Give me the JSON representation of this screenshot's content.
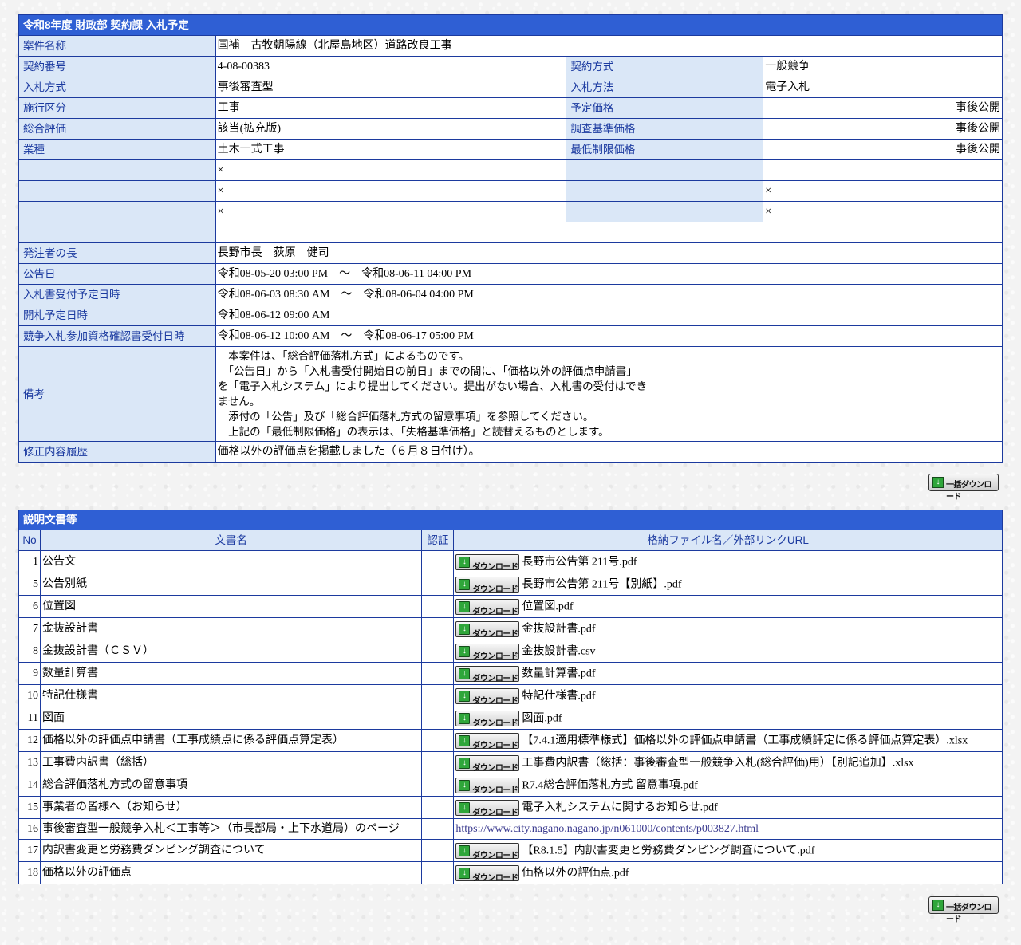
{
  "info": {
    "title": "令和8年度 財政部 契約課 入札予定",
    "case_name_label": "案件名称",
    "case_name": "国補　古牧朝陽線（北屋島地区）道路改良工事",
    "contract_no_label": "契約番号",
    "contract_no": "4-08-00383",
    "contract_method_label": "契約方式",
    "contract_method": "一般競争",
    "bid_type_label": "入札方式",
    "bid_type": "事後審査型",
    "bid_method_label": "入札方法",
    "bid_method": "電子入札",
    "category_label": "施行区分",
    "category": "工事",
    "planned_price_label": "予定価格",
    "planned_price": "事後公開",
    "overall_eval_label": "総合評価",
    "overall_eval": "該当(拡充版)",
    "survey_price_label": "調査基準価格",
    "survey_price": "事後公開",
    "industry_label": "業種",
    "industry": "土木一式工事",
    "min_price_label": "最低制限価格",
    "min_price": "事後公開",
    "mark_x": "×",
    "orderer_label": "発注者の長",
    "orderer": "長野市長　荻原　健司",
    "announce_label": "公告日",
    "announce": "令和08-05-20 03:00 PM　～　令和08-06-11 04:00 PM",
    "receipt_label": "入札書受付予定日時",
    "receipt": "令和08-06-03 08:30 AM　～　令和08-06-04 04:00 PM",
    "opening_label": "開札予定日時",
    "opening": "令和08-06-12 09:00 AM",
    "qualify_label": "競争入札参加資格確認書受付日時",
    "qualify": "令和08-06-12 10:00 AM　～　令和08-06-17 05:00 PM",
    "remarks_label": "備考",
    "remarks": "　本案件は、「総合評価落札方式」によるものです。\n　「公告日」から「入札書受付開始日の前日」までの間に、「価格以外の評価点申請書」\nを「電子入札システム」により提出してください。提出がない場合、入札書の受付はでき\nません。\n　添付の「公告」及び「総合評価落札方式の留意事項」を参照してください。\n　上記の「最低制限価格」の表示は、「失格基準価格」と読替えるものとします。",
    "revision_label": "修正内容履歴",
    "revision": "価格以外の評価点を掲載しました（６月８日付け）。"
  },
  "bulk_download_label": "一括ダウンロード",
  "download_label": "ダウンロード",
  "docs": {
    "title": "説明文書等",
    "col_no": "No",
    "col_name": "文書名",
    "col_auth": "認証",
    "col_file": "格納ファイル名／外部リンクURL",
    "rows": [
      {
        "no": "1",
        "name": "公告文",
        "file": "長野市公告第 211号.pdf"
      },
      {
        "no": "5",
        "name": "公告別紙",
        "file": "長野市公告第 211号【別紙】.pdf"
      },
      {
        "no": "6",
        "name": "位置図",
        "file": "位置図.pdf"
      },
      {
        "no": "7",
        "name": "金抜設計書",
        "file": "金抜設計書.pdf"
      },
      {
        "no": "8",
        "name": "金抜設計書（ＣＳＶ）",
        "file": "金抜設計書.csv"
      },
      {
        "no": "9",
        "name": "数量計算書",
        "file": "数量計算書.pdf"
      },
      {
        "no": "10",
        "name": "特記仕様書",
        "file": "特記仕様書.pdf"
      },
      {
        "no": "11",
        "name": "図面",
        "file": "図面.pdf"
      },
      {
        "no": "12",
        "name": "価格以外の評価点申請書（工事成績点に係る評価点算定表）",
        "file": "【7.4.1適用標準様式】価格以外の評価点申請書（工事成績評定に係る評価点算定表）.xlsx"
      },
      {
        "no": "13",
        "name": "工事費内訳書（総括）",
        "file": "工事費内訳書（総括：事後審査型一般競争入札(総合評価)用）【別記追加】.xlsx"
      },
      {
        "no": "14",
        "name": "総合評価落札方式の留意事項",
        "file": "R7.4総合評価落札方式 留意事項.pdf"
      },
      {
        "no": "15",
        "name": "事業者の皆様へ（お知らせ）",
        "file": "電子入札システムに関するお知らせ.pdf"
      },
      {
        "no": "16",
        "name": "事後審査型一般競争入札＜工事等＞（市長部局・上下水道局）のページ",
        "link": "https://www.city.nagano.nagano.jp/n061000/contents/p003827.html"
      },
      {
        "no": "17",
        "name": "内訳書変更と労務費ダンピング調査について",
        "file": "【R8.1.5】内訳書変更と労務費ダンピング調査について.pdf"
      },
      {
        "no": "18",
        "name": "価格以外の評価点",
        "file": "価格以外の評価点.pdf"
      }
    ]
  }
}
